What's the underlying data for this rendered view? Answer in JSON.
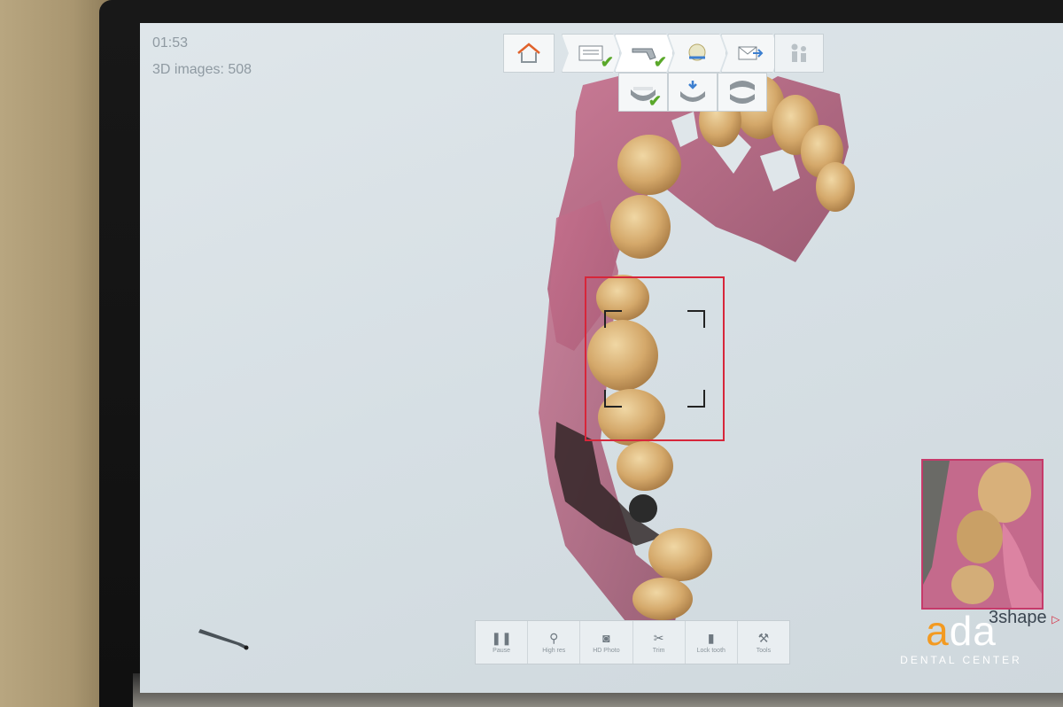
{
  "status": {
    "timer": "01:53",
    "images_count": "3D images: 508"
  },
  "workflow": {
    "steps": [
      {
        "name": "home",
        "icon": "home-icon"
      },
      {
        "name": "order",
        "icon": "order-form-icon",
        "done": true
      },
      {
        "name": "scan",
        "icon": "scanner-icon",
        "done": true
      },
      {
        "name": "color",
        "icon": "color-ball-icon"
      },
      {
        "name": "send",
        "icon": "send-mail-icon"
      },
      {
        "name": "patient",
        "icon": "people-icon"
      }
    ],
    "substeps": [
      {
        "name": "lower-jaw",
        "icon": "lower-jaw-icon",
        "done": true
      },
      {
        "name": "upper-jaw",
        "icon": "upper-jaw-icon"
      },
      {
        "name": "bite",
        "icon": "bite-icon"
      }
    ],
    "check_mark": "✔"
  },
  "toolbar": {
    "items": [
      {
        "label": "Pause",
        "icon": "pause-icon",
        "glyph": "❚❚"
      },
      {
        "label": "High res",
        "icon": "microscope-icon",
        "glyph": "⚲"
      },
      {
        "label": "HD Photo",
        "icon": "camera-icon",
        "glyph": "◙"
      },
      {
        "label": "Trim",
        "icon": "scissors-icon",
        "glyph": "✂"
      },
      {
        "label": "Lock tooth",
        "icon": "trash-icon",
        "glyph": "▮"
      },
      {
        "label": "Tools",
        "icon": "wrench-icon",
        "glyph": "⚒"
      }
    ]
  },
  "branding": {
    "software": "3shape",
    "software_mark": "▷",
    "watermark_word_a1": "a",
    "watermark_word_rest": "da",
    "watermark_sub": "DENTAL CENTER"
  },
  "colors": {
    "accent_red": "#d7263a",
    "check_green": "#5aa82a",
    "ada_orange": "#f39a21",
    "gum_pink": "#b05c78",
    "tooth": "#d9b274"
  }
}
